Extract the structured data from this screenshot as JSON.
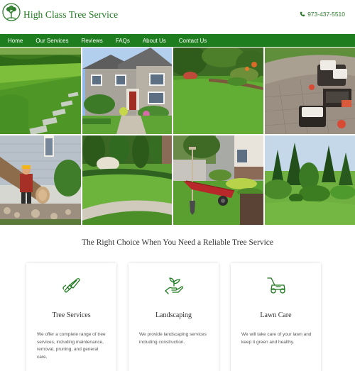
{
  "brand": {
    "name": "High Class Tree Service",
    "phone": "973-437-5510",
    "logo_icon": "tree-logo-icon",
    "phone_icon": "phone-icon",
    "accent_color": "#1e7d1e"
  },
  "nav": {
    "items": [
      {
        "label": "Home"
      },
      {
        "label": "Our Services"
      },
      {
        "label": "Reviews"
      },
      {
        "label": "FAQs"
      },
      {
        "label": "About Us"
      },
      {
        "label": "Contact Us"
      }
    ]
  },
  "gallery": {
    "images": [
      "lawn-with-stepping-stones-photo",
      "house-front-landscaping-photo",
      "garden-lawn-with-flowers-photo",
      "stone-patio-with-furniture-photo",
      "tree-removal-worker-photo",
      "curved-lawn-hedges-photo",
      "garden-shovel-wheelbarrow-photo",
      "evergreen-garden-photo"
    ]
  },
  "main": {
    "tagline": "The Right Choice When You Need a Reliable Tree Service"
  },
  "services": [
    {
      "icon": "chainsaw-icon",
      "title": "Tree Services",
      "desc": "We offer a complete range of tree services, including maintenance, removal, pruning, and general care."
    },
    {
      "icon": "hand-plant-icon",
      "title": "Landscaping",
      "desc": "We provide landscaping services including construction."
    },
    {
      "icon": "lawn-mower-icon",
      "title": "Lawn Care",
      "desc": "We will take care of your lawn and keep it green and healthy."
    }
  ]
}
